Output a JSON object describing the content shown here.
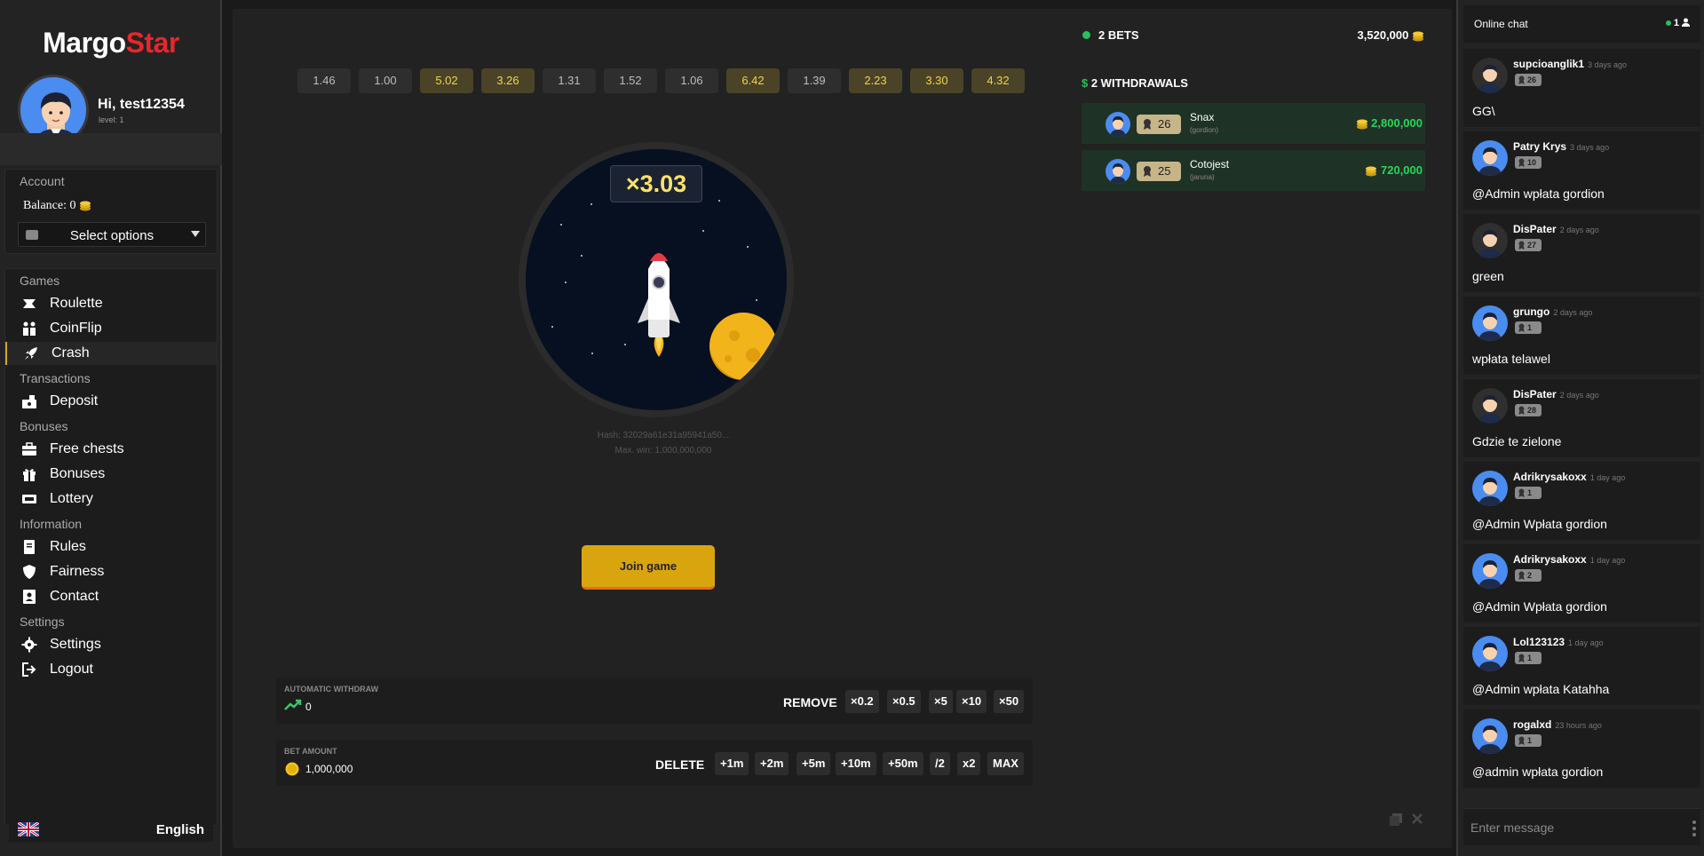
{
  "brand": {
    "part1": "Margo",
    "part2": "Star"
  },
  "user": {
    "greeting": "Hi, test12354",
    "level": "level: 1"
  },
  "account": {
    "label": "Account",
    "balance": "Balance: 0",
    "select_placeholder": "Select options"
  },
  "nav": {
    "games_label": "Games",
    "roulette": "Roulette",
    "coinflip": "CoinFlip",
    "crash": "Crash",
    "transactions_label": "Transactions",
    "deposit": "Deposit",
    "bonuses_label": "Bonuses",
    "free_chests": "Free chests",
    "bonuses": "Bonuses",
    "lottery": "Lottery",
    "information_label": "Information",
    "rules": "Rules",
    "fairness": "Fairness",
    "contact": "Contact",
    "settings_label": "Settings",
    "settings": "Settings",
    "logout": "Logout"
  },
  "language": "English",
  "history": [
    "1.46",
    "1.00",
    "5.02",
    "3.26",
    "1.31",
    "1.52",
    "1.06",
    "6.42",
    "1.39",
    "2.23",
    "3.30",
    "4.32"
  ],
  "game": {
    "multiplier": "×3.03",
    "hash": "Hash: 32029a61e31a95941a50...",
    "max_win": "Max. win: 1,000,000,000",
    "join_label": "Join game"
  },
  "auto_withdraw": {
    "caption": "AUTOMATIC WITHDRAW",
    "value": "0",
    "remove_label": "REMOVE",
    "chips": [
      "×0.2",
      "×0.5",
      "×5",
      "×10",
      "×50"
    ]
  },
  "bet_amount": {
    "caption": "BET AMOUNT",
    "value": "1,000,000",
    "delete_label": "DELETE",
    "chips": [
      "+1m",
      "+2m",
      "+5m",
      "+10m",
      "+50m",
      "/2",
      "x2",
      "MAX"
    ]
  },
  "bets": {
    "label": "2 BETS",
    "total": "3,520,000"
  },
  "withdrawals": {
    "label": "2 WITHDRAWALS",
    "rows": [
      {
        "level": "26",
        "name": "Snax",
        "sub": "(gordion)",
        "amount": "2,800,000"
      },
      {
        "level": "25",
        "name": "Cotojest",
        "sub": "(jaruna)",
        "amount": "720,000"
      }
    ]
  },
  "chat": {
    "title": "Online chat",
    "online": "1",
    "placeholder": "Enter message",
    "messages": [
      {
        "name": "supcioanglik1",
        "time": "3 days ago",
        "level": "26",
        "text": "GG\\"
      },
      {
        "name": "Patry Krys",
        "time": "3 days ago",
        "level": "10",
        "text": "@Admin wpłata gordion"
      },
      {
        "name": "DisPater",
        "time": "2 days ago",
        "level": "27",
        "text": "green"
      },
      {
        "name": "grungo",
        "time": "2 days ago",
        "level": "1",
        "text": "wpłata telawel"
      },
      {
        "name": "DisPater",
        "time": "2 days ago",
        "level": "28",
        "text": "Gdzie te zielone"
      },
      {
        "name": "Adrikrysakoxx",
        "time": "1 day ago",
        "level": "1",
        "text": "@Admin Wpłata gordion"
      },
      {
        "name": "Adrikrysakoxx",
        "time": "1 day ago",
        "level": "2",
        "text": "@Admin Wpłata gordion"
      },
      {
        "name": "Lol123123",
        "time": "1 day ago",
        "level": "1",
        "text": "@Admin wpłata Katahha"
      },
      {
        "name": "rogalxd",
        "time": "23 hours ago",
        "level": "1",
        "text": "@admin wpłata gordion"
      }
    ]
  },
  "colors": {
    "accent": "#d9a50e",
    "brand_red": "#e8262b",
    "green": "#27d65a",
    "gold_text": "#f2d34a"
  }
}
